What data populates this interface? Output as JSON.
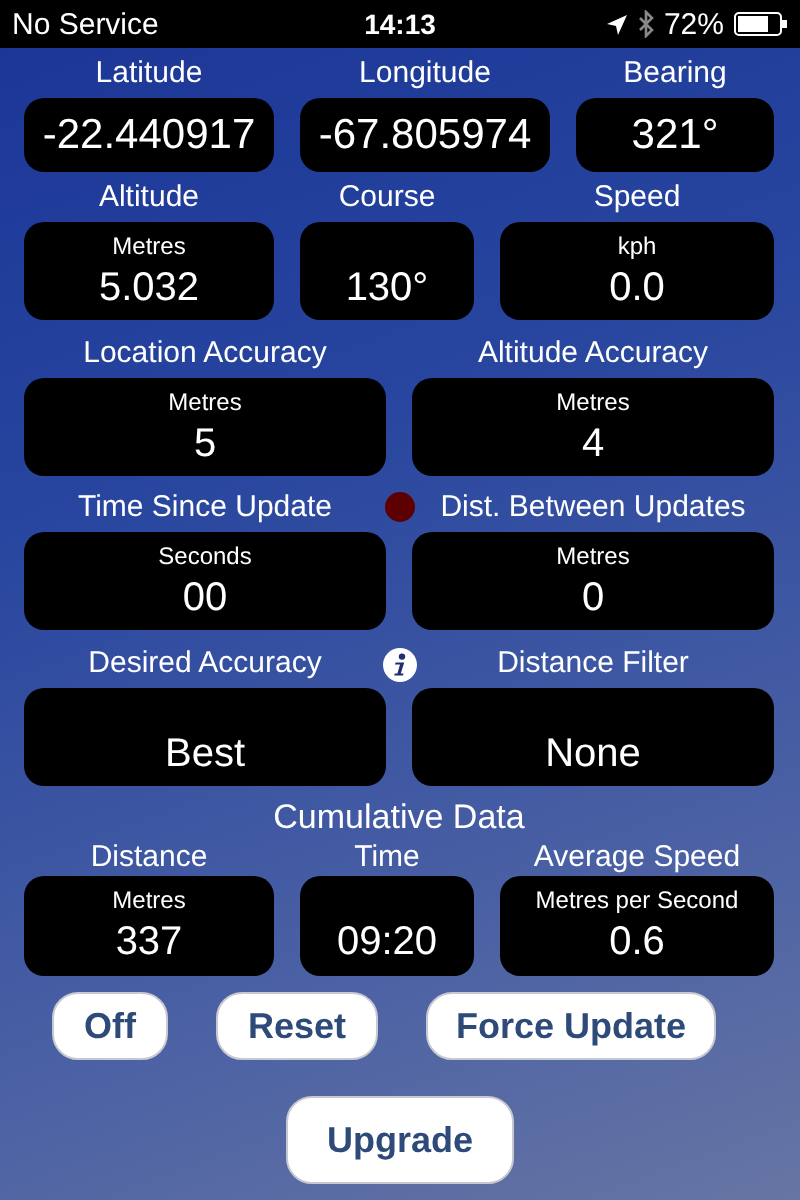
{
  "status_bar": {
    "carrier": "No Service",
    "time": "14:13",
    "battery": "72%"
  },
  "rows": [
    {
      "kind": "coords",
      "fields": [
        {
          "label": "Latitude",
          "value": "-22.440917"
        },
        {
          "label": "Longitude",
          "value": "-67.805974"
        },
        {
          "label": "Bearing",
          "value": "321°"
        }
      ]
    },
    {
      "kind": "motion",
      "fields": [
        {
          "label": "Altitude",
          "unit": "Metres",
          "value": "5.032"
        },
        {
          "label": "Course",
          "value": "130°"
        },
        {
          "label": "Speed",
          "unit": "kph",
          "value": "0.0"
        }
      ]
    },
    {
      "kind": "pair",
      "fields": [
        {
          "label": "Location Accuracy",
          "unit": "Metres",
          "value": "5"
        },
        {
          "label": "Altitude Accuracy",
          "unit": "Metres",
          "value": "4"
        }
      ]
    },
    {
      "kind": "pair",
      "between": {
        "kind": "status-light"
      },
      "fields": [
        {
          "label": "Time Since Update",
          "unit": "Seconds",
          "value": "00"
        },
        {
          "label": "Dist. Between Updates",
          "unit": "Metres",
          "value": "0"
        }
      ]
    },
    {
      "kind": "pair",
      "between": {
        "kind": "info"
      },
      "fields": [
        {
          "label": "Desired Accuracy",
          "value": "Best"
        },
        {
          "label": "Distance Filter",
          "value": "None"
        }
      ]
    }
  ],
  "cumulative": {
    "title": "Cumulative Data",
    "kind": "motion",
    "fields": [
      {
        "label": "Distance",
        "unit": "Metres",
        "value": "337"
      },
      {
        "label": "Time",
        "value": "09:20"
      },
      {
        "label": "Average Speed",
        "unit": "Metres per Second",
        "value": "0.6"
      }
    ]
  },
  "buttons": [
    "Off",
    "Reset",
    "Force Update"
  ],
  "upgrade_button": "Upgrade"
}
